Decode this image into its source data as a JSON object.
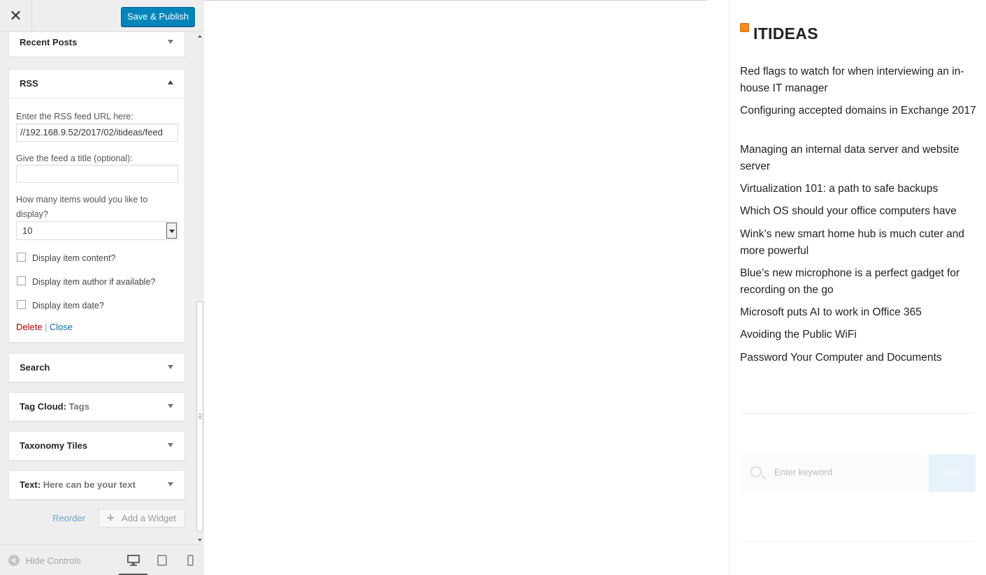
{
  "topbar": {
    "close_glyph": "✕",
    "save_label": "Save & Publish"
  },
  "widgets": {
    "recent_posts": "Recent Posts",
    "rss": {
      "title": "RSS",
      "url_label": "Enter the RSS feed URL here:",
      "url_value": "//192.168.9.52/2017/02/itideas/feed",
      "title_label": "Give the feed a title (optional):",
      "title_value": "",
      "count_label_1": "How many items would you like to",
      "count_label_2": "display?",
      "count_value": "10",
      "cb_content": "Display item content?",
      "cb_author": "Display item author if available?",
      "cb_date": "Display item date?",
      "delete": "Delete",
      "sep": "|",
      "close": "Close"
    },
    "search": "Search",
    "tag_cloud": {
      "title": "Tag Cloud:",
      "sub": "Tags"
    },
    "taxonomy": "Taxonomy Tiles",
    "text": {
      "title": "Text:",
      "sub": "Here can be your text"
    }
  },
  "actions": {
    "reorder": "Reorder",
    "add_widget": "Add a Widget"
  },
  "footer": {
    "hide_controls": "Hide Controls"
  },
  "preview": {
    "rss_title": "ITIDEAS",
    "feed_items": [
      "Red flags to watch for when interviewing an in-house IT manager",
      "Configuring accepted domains in Exchange 2017",
      "Managing an internal data server and website server",
      "Virtualization 101: a path to safe backups",
      "Which OS should your office computers have",
      "Wink’s new smart home hub is much cuter and more powerful",
      "Blue’s new microphone is a perfect gadget for recording on the go",
      "Microsoft puts AI to work in Office 365",
      "Avoiding the Public WiFi",
      "Password Your Computer and Documents"
    ],
    "search_placeholder": "Enter keyword",
    "go_label": "Go!"
  },
  "colors": {
    "accent": "#0085ba",
    "delete": "#aa0000",
    "link": "#0073aa",
    "rss": "#f28c1c"
  },
  "icons": [
    "close-icon",
    "chevron-down-icon",
    "chevron-up-icon",
    "plus-icon",
    "rss-icon",
    "search-icon",
    "desktop-icon",
    "tablet-icon",
    "mobile-icon",
    "hide-controls-icon"
  ]
}
